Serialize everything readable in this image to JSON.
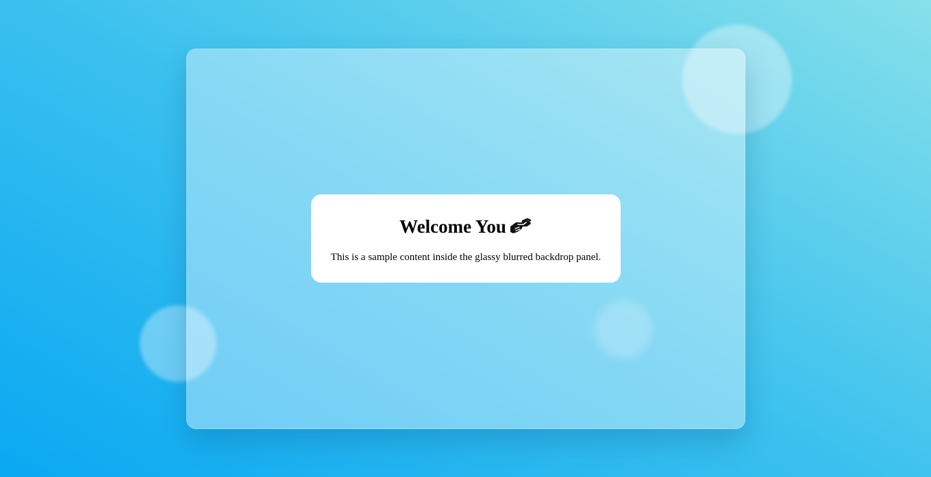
{
  "card": {
    "title": "Welcome You",
    "title_icon": "handshake-icon",
    "text": "This is a sample content inside the glassy blurred backdrop panel."
  },
  "colors": {
    "background_start": "#0aa8f2",
    "background_mid": "#3cc1ee",
    "background_end": "#86e0ea",
    "card_background": "#ffffff",
    "text": "#000000"
  }
}
